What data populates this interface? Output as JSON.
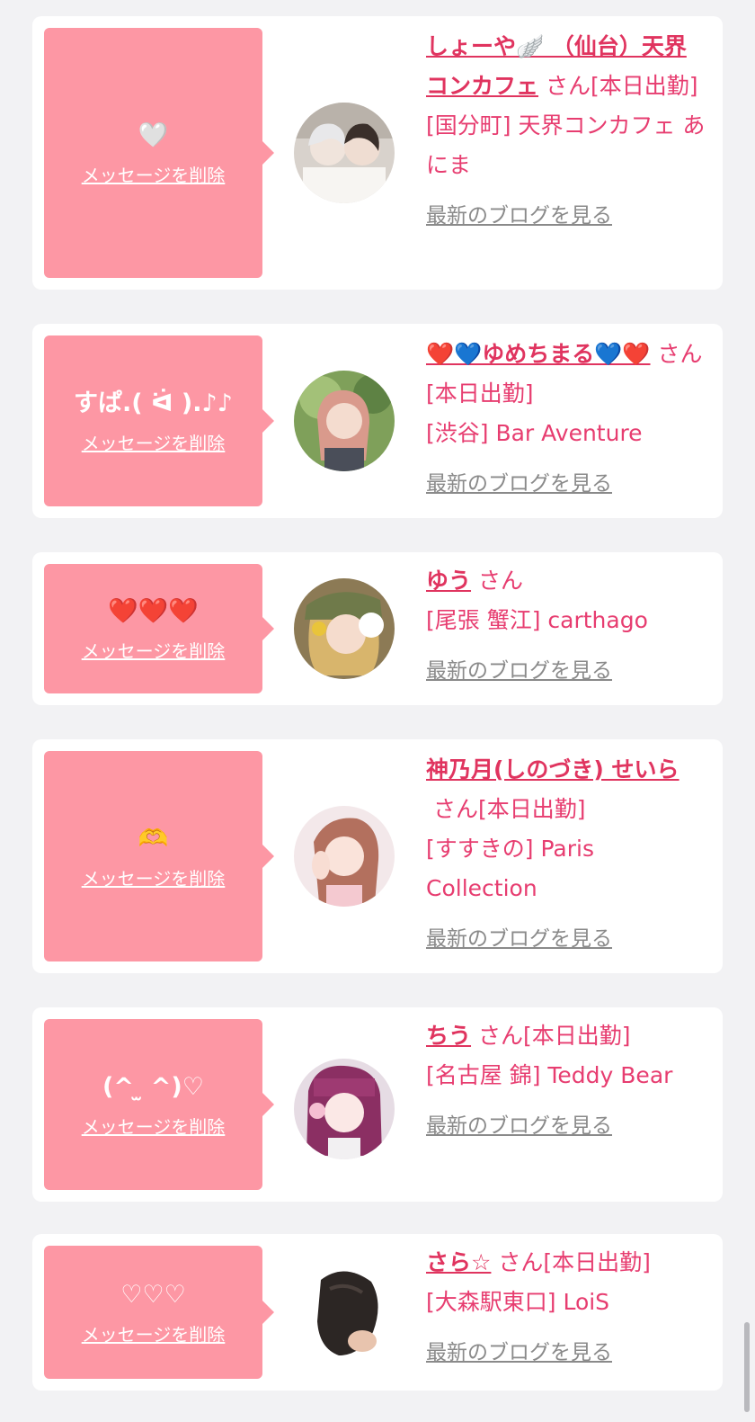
{
  "delete_label": "メッセージを削除",
  "blog_label": "最新のブログを見る",
  "cards": [
    {
      "message": "🤍",
      "name": "しょーや🪽 （仙台）天界コンカフェ",
      "suffix": "さん[本日出勤]",
      "shop": "[国分町] 天界コンカフェ あにま"
    },
    {
      "message": "すぱ.( ᐛ ).♪♪",
      "name": "❤️💙ゆめちまる💙❤️",
      "suffix": "さん[本日出勤]",
      "shop": "[渋谷] Bar Aventure"
    },
    {
      "message": "❤️❤️❤️",
      "name": "ゆう",
      "suffix": "さん",
      "shop": "[尾張 蟹江] carthago"
    },
    {
      "message": "🫶",
      "name": "神乃月(しのづき) せいら",
      "suffix": "さん[本日出勤]",
      "shop": "[すすきの] Paris Collection"
    },
    {
      "message": "(^ ̫ ^)♡",
      "name": "ちう",
      "suffix": "さん[本日出勤]",
      "shop": "[名古屋 錦] Teddy Bear"
    },
    {
      "message": "♡♡♡",
      "name": "さら☆",
      "suffix": "さん[本日出勤]",
      "shop": "[大森駅東口] LoiS"
    }
  ]
}
